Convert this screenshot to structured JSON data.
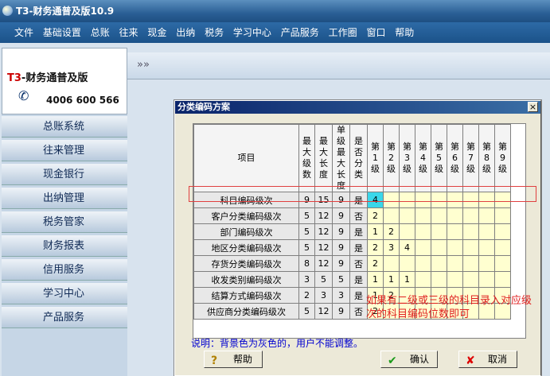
{
  "window": {
    "title": "T3-财务通普及版10.9"
  },
  "menu": [
    "文件",
    "基础设置",
    "总账",
    "往来",
    "现金",
    "出纳",
    "税务",
    "学习中心",
    "产品服务",
    "工作圈",
    "窗口",
    "帮助"
  ],
  "logo": {
    "brand_prefix": "T3",
    "brand_text": "-财务通普及版",
    "phone": "4006 600 566"
  },
  "nav": [
    "总账系统",
    "往来管理",
    "现金银行",
    "出纳管理",
    "税务管家",
    "财务报表",
    "信用服务",
    "学习中心",
    "产品服务"
  ],
  "toolstrip": {
    "arrows": "»»"
  },
  "dialog": {
    "title": "分类编码方案",
    "close": "×",
    "headers": {
      "item": "项目",
      "max_levels": "最大级数",
      "max_length": "最大长度",
      "max_single": "单级最大长度",
      "is_class": "是否分类",
      "levels": [
        "第1级",
        "第2级",
        "第3级",
        "第4级",
        "第5级",
        "第6级",
        "第7级",
        "第8级",
        "第9级"
      ]
    },
    "rows": [
      {
        "name": "科目编码级次",
        "max_levels": "9",
        "max_length": "15",
        "max_single": "9",
        "is_class": "是",
        "levels": [
          "4",
          "",
          "",
          "",
          "",
          "",
          "",
          "",
          ""
        ]
      },
      {
        "name": "客户分类编码级次",
        "max_levels": "5",
        "max_length": "12",
        "max_single": "9",
        "is_class": "否",
        "levels": [
          "2",
          "",
          "",
          "",
          "",
          "",
          "",
          "",
          ""
        ]
      },
      {
        "name": "部门编码级次",
        "max_levels": "5",
        "max_length": "12",
        "max_single": "9",
        "is_class": "是",
        "levels": [
          "1",
          "2",
          "",
          "",
          "",
          "",
          "",
          "",
          ""
        ]
      },
      {
        "name": "地区分类编码级次",
        "max_levels": "5",
        "max_length": "12",
        "max_single": "9",
        "is_class": "是",
        "levels": [
          "2",
          "3",
          "4",
          "",
          "",
          "",
          "",
          "",
          ""
        ]
      },
      {
        "name": "存货分类编码级次",
        "max_levels": "8",
        "max_length": "12",
        "max_single": "9",
        "is_class": "否",
        "levels": [
          "2",
          "",
          "",
          "",
          "",
          "",
          "",
          "",
          ""
        ]
      },
      {
        "name": "收发类别编码级次",
        "max_levels": "3",
        "max_length": "5",
        "max_single": "5",
        "is_class": "是",
        "levels": [
          "1",
          "1",
          "1",
          "",
          "",
          "",
          "",
          "",
          ""
        ]
      },
      {
        "name": "结算方式编码级次",
        "max_levels": "2",
        "max_length": "3",
        "max_single": "3",
        "is_class": "是",
        "levels": [
          "1",
          "2",
          "",
          "",
          "",
          "",
          "",
          "",
          ""
        ]
      },
      {
        "name": "供应商分类编码级次",
        "max_levels": "5",
        "max_length": "12",
        "max_single": "9",
        "is_class": "否",
        "levels": [
          "2",
          "",
          "",
          "",
          "",
          "",
          "",
          "",
          ""
        ]
      }
    ],
    "annotation": "如果有二级或三级的科目录入对应级次的科目编码位数即可",
    "description": "说明：背景色为灰色的，用户不能调整。",
    "buttons": {
      "help": "帮助",
      "ok": "确认",
      "cancel": "取消"
    },
    "colors": {
      "note": "#e02020",
      "selected_cell": "#3ad7ea",
      "editable_cell": "#ffffd0"
    }
  }
}
